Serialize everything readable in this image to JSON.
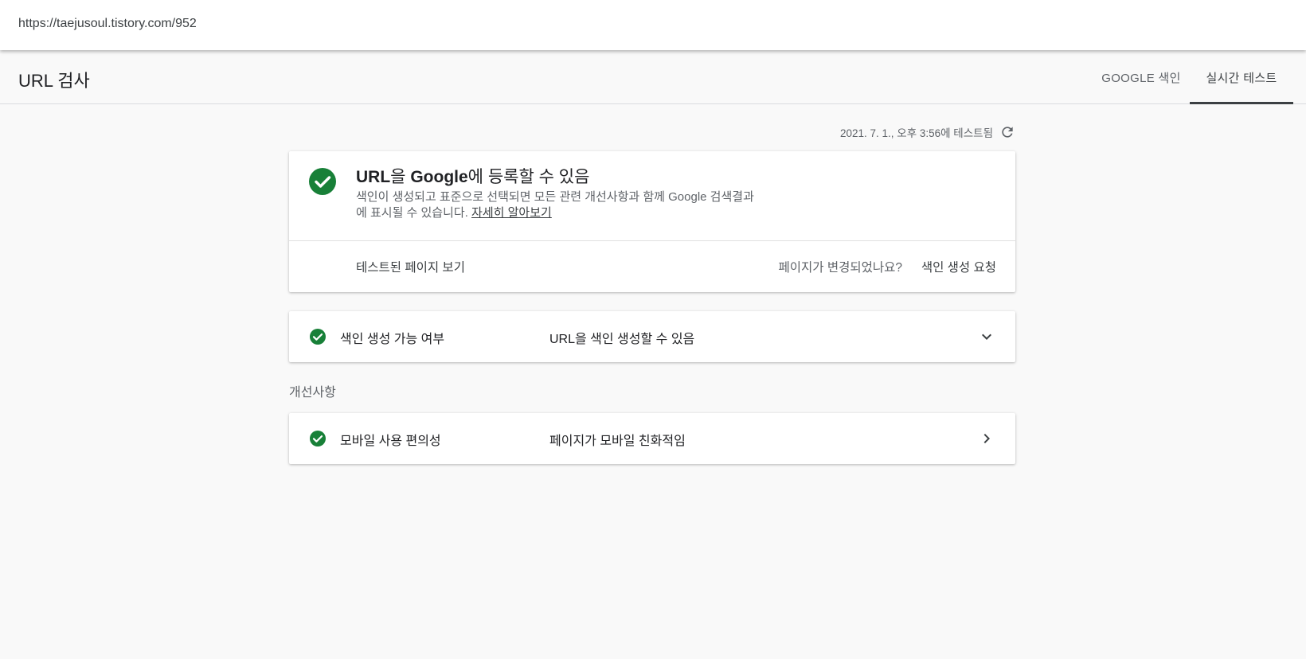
{
  "browser": {
    "url": "https://taejusoul.tistory.com/952"
  },
  "header": {
    "title": "URL 검사",
    "tabs": [
      {
        "label": "GOOGLE 색인",
        "active": false
      },
      {
        "label": "실시간 테스트",
        "active": true
      }
    ]
  },
  "test": {
    "timestamp": "2021. 7. 1., 오후 3:56에 테스트됨"
  },
  "result_card": {
    "title_part1": "URL",
    "title_part2": "을 ",
    "title_part3": "Google",
    "title_part4": "에 등록할 수 있음",
    "desc_line1": "색인이 생성되고 표준으로 선택되면 모든 관련 개선사항과 함께 Google 검색결과",
    "desc_line2": "에 표시될 수 있습니다.",
    "learn_more": "자세히 알아보기",
    "view_tested_page": "테스트된 페이지 보기",
    "page_changed": "페이지가 변경되었나요?",
    "request_indexing": "색인 생성 요청"
  },
  "indexability": {
    "label": "색인 생성 가능 여부",
    "value": "URL을 색인 생성할 수 있음",
    "icon": "chevron-down-icon"
  },
  "enhancements": {
    "section_label": "개선사항",
    "items": [
      {
        "label": "모바일 사용 편의성",
        "value": "페이지가 모바일 친화적임",
        "icon": "chevron-right-icon"
      }
    ]
  },
  "colors": {
    "success": "#188038",
    "active_tab": "#3c4043",
    "background": "#f9f9f9"
  }
}
